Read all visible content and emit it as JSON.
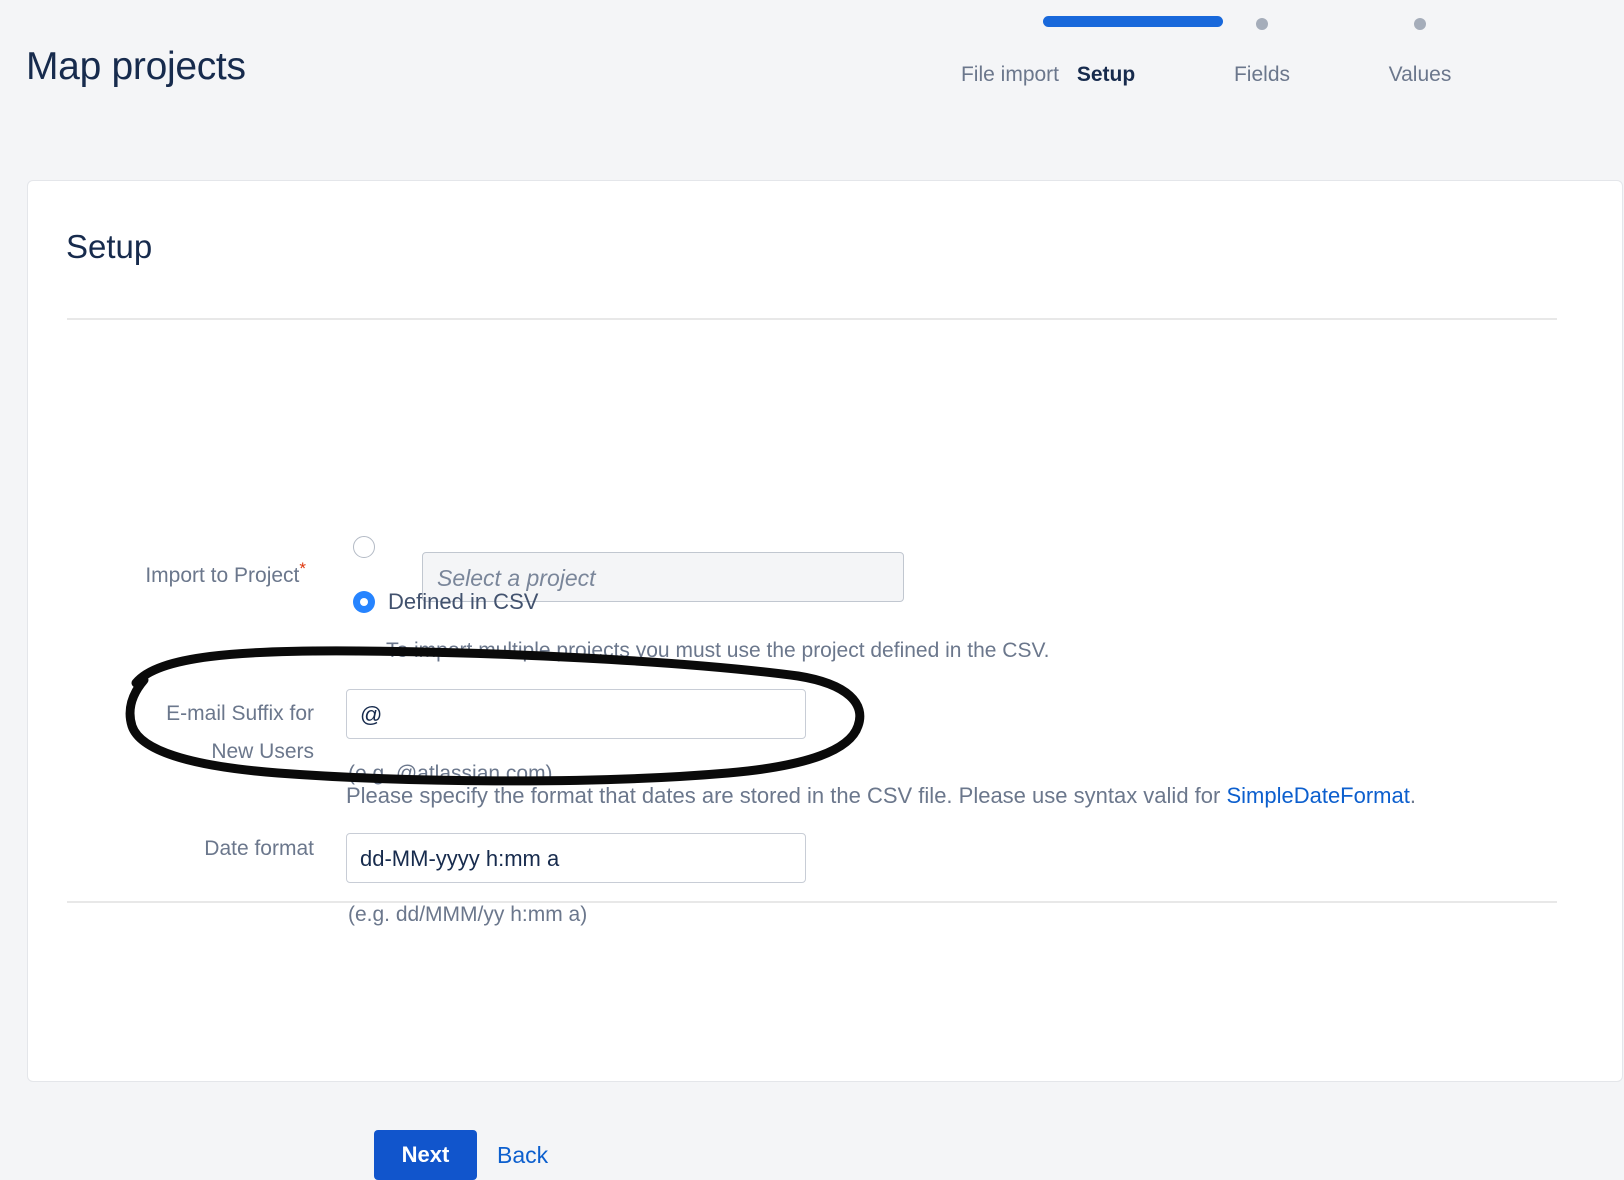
{
  "header": {
    "title": "Map projects"
  },
  "stepper": {
    "steps": [
      {
        "label": "File import",
        "state": "complete"
      },
      {
        "label": "Setup",
        "state": "active"
      },
      {
        "label": "Fields",
        "state": "upcoming"
      },
      {
        "label": "Values",
        "state": "upcoming"
      }
    ],
    "accent_color": "#1868db",
    "dot_color": "#a5adba"
  },
  "card": {
    "title": "Setup",
    "fields": {
      "import_to_project": {
        "label": "Import to Project",
        "required_marker": "*",
        "options": [
          {
            "label": "",
            "selected": false,
            "control": "select"
          },
          {
            "label": "Defined in CSV",
            "selected": true,
            "control": "radio"
          }
        ],
        "select_placeholder": "Select a project",
        "help": "To import multiple projects you must use the project defined in the CSV."
      },
      "email_suffix": {
        "label_line1": "E-mail Suffix for",
        "label_line2": "New Users",
        "value": "@",
        "hint": "(e.g. @atlassian.com)"
      },
      "date_format": {
        "label": "Date format",
        "value": "dd-MM-yyyy h:mm a",
        "hint": "(e.g. dd/MMM/yy h:mm a)",
        "description_part1": "Please specify the format that dates are stored in the CSV file. Please use syntax valid for",
        "link_text": "SimpleDateFormat",
        "description_part2": "."
      }
    },
    "actions": {
      "next_label": "Next",
      "back_label": "Back",
      "next_color": "#1155cc",
      "link_color": "#0c5fce"
    }
  },
  "annotation": {
    "shape": "hand-drawn-ellipse",
    "color": "#000000",
    "targets": "date-format-row"
  }
}
